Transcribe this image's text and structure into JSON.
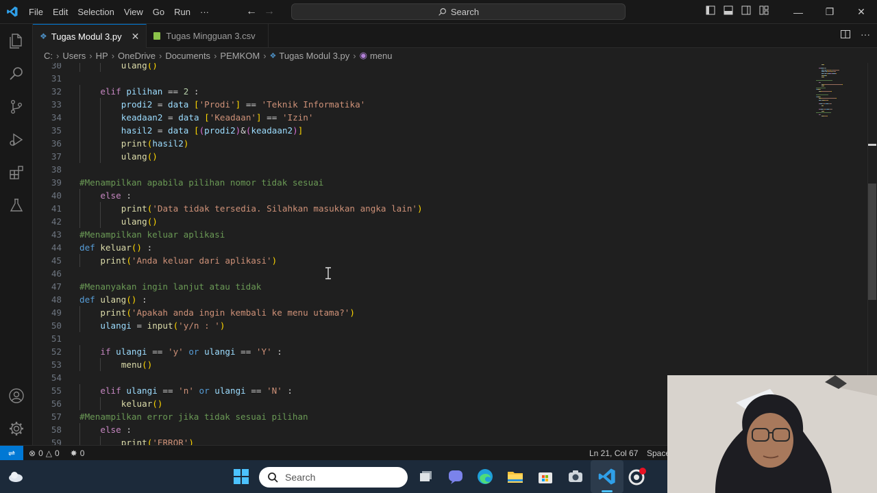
{
  "menu": [
    "File",
    "Edit",
    "Selection",
    "View",
    "Go",
    "Run",
    "···"
  ],
  "search": {
    "label": "Search"
  },
  "tabs": [
    {
      "label": "Tugas Modul 3.py",
      "active": true,
      "icon": "python-icon"
    },
    {
      "label": "Tugas Mingguan 3.csv",
      "active": false,
      "icon": "csv-icon"
    }
  ],
  "breadcrumb": [
    "C:",
    "Users",
    "HP",
    "OneDrive",
    "Documents",
    "PEMKOM",
    "Tugas Modul 3.py",
    "menu"
  ],
  "editor": {
    "lines": [
      {
        "n": "30",
        "indent": 2,
        "code": [
          [
            "fn",
            "ulang"
          ],
          [
            "br1",
            "()"
          ]
        ]
      },
      {
        "n": "31",
        "indent": 0,
        "code": []
      },
      {
        "n": "32",
        "indent": 1,
        "code": [
          [
            "ctl",
            "elif "
          ],
          [
            "var",
            "pilihan"
          ],
          [
            "op",
            " == "
          ],
          [
            "num",
            "2"
          ],
          [
            "op",
            " :"
          ]
        ]
      },
      {
        "n": "33",
        "indent": 2,
        "code": [
          [
            "var",
            "prodi2"
          ],
          [
            "op",
            " = "
          ],
          [
            "var",
            "data"
          ],
          [
            "op",
            " "
          ],
          [
            "br1",
            "["
          ],
          [
            "str",
            "'Prodi'"
          ],
          [
            "br1",
            "]"
          ],
          [
            "op",
            " == "
          ],
          [
            "str",
            "'Teknik Informatika'"
          ]
        ]
      },
      {
        "n": "34",
        "indent": 2,
        "code": [
          [
            "var",
            "keadaan2"
          ],
          [
            "op",
            " = "
          ],
          [
            "var",
            "data"
          ],
          [
            "op",
            " "
          ],
          [
            "br1",
            "["
          ],
          [
            "str",
            "'Keadaan'"
          ],
          [
            "br1",
            "]"
          ],
          [
            "op",
            " == "
          ],
          [
            "str",
            "'Izin'"
          ]
        ]
      },
      {
        "n": "35",
        "indent": 2,
        "code": [
          [
            "var",
            "hasil2"
          ],
          [
            "op",
            " = "
          ],
          [
            "var",
            "data"
          ],
          [
            "op",
            " "
          ],
          [
            "br1",
            "["
          ],
          [
            "br2",
            "("
          ],
          [
            "var",
            "prodi2"
          ],
          [
            "br2",
            ")"
          ],
          [
            "op",
            "&"
          ],
          [
            "br2",
            "("
          ],
          [
            "var",
            "keadaan2"
          ],
          [
            "br2",
            ")"
          ],
          [
            "br1",
            "]"
          ]
        ]
      },
      {
        "n": "36",
        "indent": 2,
        "code": [
          [
            "fn",
            "print"
          ],
          [
            "br1",
            "("
          ],
          [
            "var",
            "hasil2"
          ],
          [
            "br1",
            ")"
          ]
        ]
      },
      {
        "n": "37",
        "indent": 2,
        "code": [
          [
            "fn",
            "ulang"
          ],
          [
            "br1",
            "()"
          ]
        ]
      },
      {
        "n": "38",
        "indent": 0,
        "code": []
      },
      {
        "n": "39",
        "indent": 0,
        "code": [
          [
            "cmt",
            "#Menampilkan apabila pilihan nomor tidak sesuai"
          ]
        ]
      },
      {
        "n": "40",
        "indent": 1,
        "code": [
          [
            "ctl",
            "else"
          ],
          [
            "op",
            " :"
          ]
        ]
      },
      {
        "n": "41",
        "indent": 2,
        "code": [
          [
            "fn",
            "print"
          ],
          [
            "br1",
            "("
          ],
          [
            "str",
            "'Data tidak tersedia. Silahkan masukkan angka lain'"
          ],
          [
            "br1",
            ")"
          ]
        ]
      },
      {
        "n": "42",
        "indent": 2,
        "code": [
          [
            "fn",
            "ulang"
          ],
          [
            "br1",
            "()"
          ]
        ]
      },
      {
        "n": "43",
        "indent": 0,
        "code": [
          [
            "cmt",
            "#Menampilkan keluar aplikasi"
          ]
        ]
      },
      {
        "n": "44",
        "indent": 0,
        "code": [
          [
            "kw",
            "def "
          ],
          [
            "fn",
            "keluar"
          ],
          [
            "br1",
            "()"
          ],
          [
            "op",
            " :"
          ]
        ]
      },
      {
        "n": "45",
        "indent": 1,
        "code": [
          [
            "fn",
            "print"
          ],
          [
            "br1",
            "("
          ],
          [
            "str",
            "'Anda keluar dari aplikasi'"
          ],
          [
            "br1",
            ")"
          ]
        ]
      },
      {
        "n": "46",
        "indent": 0,
        "code": []
      },
      {
        "n": "47",
        "indent": 0,
        "code": [
          [
            "cmt",
            "#Menanyakan ingin lanjut atau tidak"
          ]
        ]
      },
      {
        "n": "48",
        "indent": 0,
        "code": [
          [
            "kw",
            "def "
          ],
          [
            "fn",
            "ulang"
          ],
          [
            "br1",
            "()"
          ],
          [
            "op",
            " :"
          ]
        ]
      },
      {
        "n": "49",
        "indent": 1,
        "code": [
          [
            "fn",
            "print"
          ],
          [
            "br1",
            "("
          ],
          [
            "str",
            "'Apakah anda ingin kembali ke menu utama?'"
          ],
          [
            "br1",
            ")"
          ]
        ]
      },
      {
        "n": "50",
        "indent": 1,
        "code": [
          [
            "var",
            "ulangi"
          ],
          [
            "op",
            " = "
          ],
          [
            "fn",
            "input"
          ],
          [
            "br1",
            "("
          ],
          [
            "str",
            "'y/n : '"
          ],
          [
            "br1",
            ")"
          ]
        ]
      },
      {
        "n": "51",
        "indent": 0,
        "code": []
      },
      {
        "n": "52",
        "indent": 1,
        "code": [
          [
            "ctl",
            "if "
          ],
          [
            "var",
            "ulangi"
          ],
          [
            "op",
            " == "
          ],
          [
            "str",
            "'y'"
          ],
          [
            "kw",
            " or "
          ],
          [
            "var",
            "ulangi"
          ],
          [
            "op",
            " == "
          ],
          [
            "str",
            "'Y'"
          ],
          [
            "op",
            " :"
          ]
        ]
      },
      {
        "n": "53",
        "indent": 2,
        "code": [
          [
            "fn",
            "menu"
          ],
          [
            "br1",
            "()"
          ]
        ]
      },
      {
        "n": "54",
        "indent": 0,
        "code": []
      },
      {
        "n": "55",
        "indent": 1,
        "code": [
          [
            "ctl",
            "elif "
          ],
          [
            "var",
            "ulangi"
          ],
          [
            "op",
            " == "
          ],
          [
            "str",
            "'n'"
          ],
          [
            "kw",
            " or "
          ],
          [
            "var",
            "ulangi"
          ],
          [
            "op",
            " == "
          ],
          [
            "str",
            "'N'"
          ],
          [
            "op",
            " :"
          ]
        ]
      },
      {
        "n": "56",
        "indent": 2,
        "code": [
          [
            "fn",
            "keluar"
          ],
          [
            "br1",
            "()"
          ]
        ]
      },
      {
        "n": "57",
        "indent": 0,
        "code": [
          [
            "cmt",
            "#Menampilkan error jika tidak sesuai pilihan"
          ]
        ]
      },
      {
        "n": "58",
        "indent": 1,
        "code": [
          [
            "ctl",
            "else"
          ],
          [
            "op",
            " :"
          ]
        ]
      },
      {
        "n": "59",
        "indent": 2,
        "code": [
          [
            "fn",
            "print"
          ],
          [
            "br1",
            "("
          ],
          [
            "str",
            "'ERROR'"
          ],
          [
            "br1",
            ")"
          ]
        ]
      }
    ]
  },
  "status": {
    "errors": "0",
    "warnings": "0",
    "ports": "0",
    "position": "Ln 21, Col 67",
    "spaces": "Spaces"
  },
  "taskbar": {
    "search_label": "Search"
  },
  "colors": {
    "accent": "#0078d4",
    "editor_bg": "#1f1f1f",
    "chrome_bg": "#181818"
  }
}
